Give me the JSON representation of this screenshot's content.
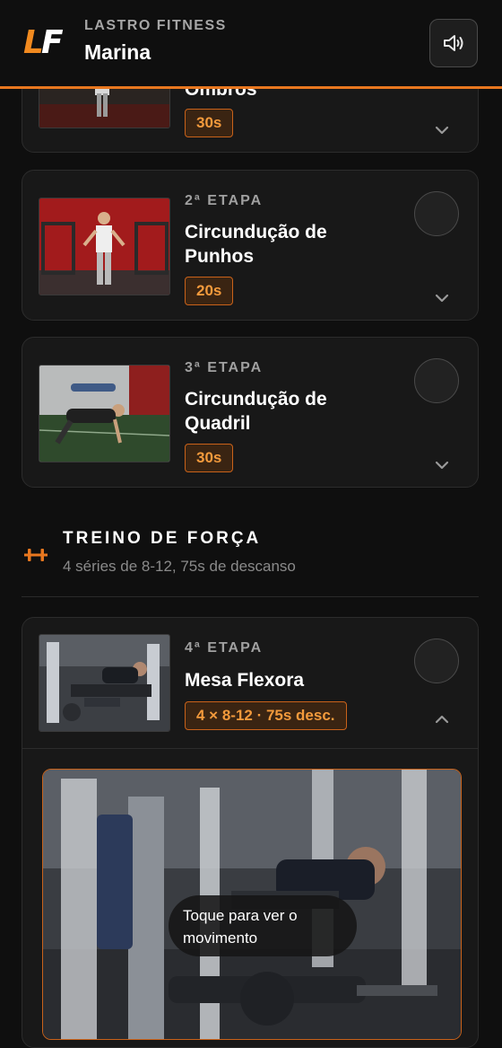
{
  "header": {
    "logo_letters": [
      "L",
      "F"
    ],
    "brand": "LASTRO FITNESS",
    "user": "Marina",
    "sound_icon": "speaker-volume-icon"
  },
  "warmup": [
    {
      "etapa": "",
      "name": "Ombros",
      "duration": "30s",
      "chevron": "chevron-down-icon"
    },
    {
      "etapa": "2ª ETAPA",
      "name": "Circundução de Punhos",
      "duration": "20s",
      "chevron": "chevron-down-icon"
    },
    {
      "etapa": "3ª ETAPA",
      "name": "Circundução de Quadril",
      "duration": "30s",
      "chevron": "chevron-down-icon"
    }
  ],
  "strength": {
    "icon": "dumbbell-icon",
    "title": "TREINO DE FORÇA",
    "subtitle": "4 séries de 8-12, 75s de descanso"
  },
  "expanded": {
    "etapa": "4ª ETAPA",
    "name": "Mesa Flexora",
    "scheme": "4 × 8-12 · 75s desc.",
    "chevron": "chevron-up-icon",
    "hint": "Toque para ver o movimento"
  },
  "colors": {
    "accent": "#e8771f",
    "badge_text": "#f39a3c",
    "background": "#0f0f0f",
    "card": "#181818"
  }
}
